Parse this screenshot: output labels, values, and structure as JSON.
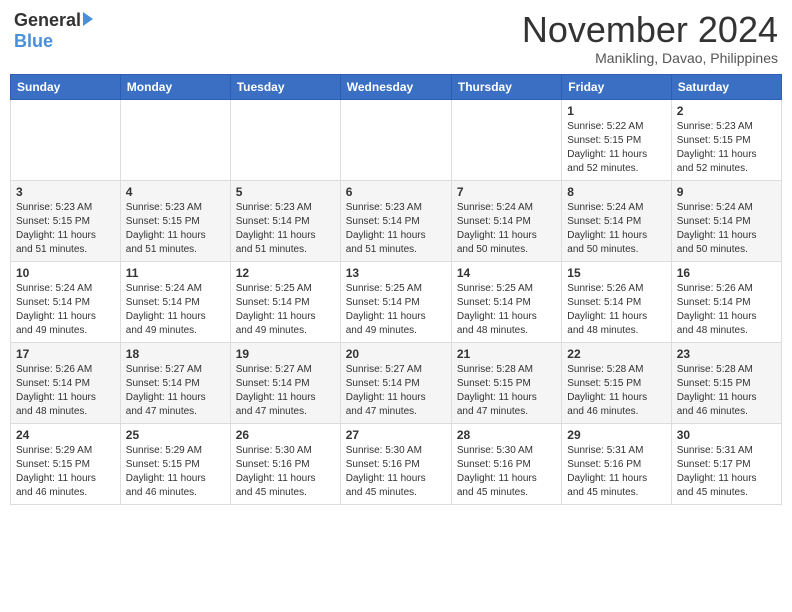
{
  "header": {
    "logo_general": "General",
    "logo_blue": "Blue",
    "month_title": "November 2024",
    "location": "Manikling, Davao, Philippines"
  },
  "calendar": {
    "days_of_week": [
      "Sunday",
      "Monday",
      "Tuesday",
      "Wednesday",
      "Thursday",
      "Friday",
      "Saturday"
    ],
    "weeks": [
      [
        {
          "day": "",
          "info": ""
        },
        {
          "day": "",
          "info": ""
        },
        {
          "day": "",
          "info": ""
        },
        {
          "day": "",
          "info": ""
        },
        {
          "day": "",
          "info": ""
        },
        {
          "day": "1",
          "info": "Sunrise: 5:22 AM\nSunset: 5:15 PM\nDaylight: 11 hours\nand 52 minutes."
        },
        {
          "day": "2",
          "info": "Sunrise: 5:23 AM\nSunset: 5:15 PM\nDaylight: 11 hours\nand 52 minutes."
        }
      ],
      [
        {
          "day": "3",
          "info": "Sunrise: 5:23 AM\nSunset: 5:15 PM\nDaylight: 11 hours\nand 51 minutes."
        },
        {
          "day": "4",
          "info": "Sunrise: 5:23 AM\nSunset: 5:15 PM\nDaylight: 11 hours\nand 51 minutes."
        },
        {
          "day": "5",
          "info": "Sunrise: 5:23 AM\nSunset: 5:14 PM\nDaylight: 11 hours\nand 51 minutes."
        },
        {
          "day": "6",
          "info": "Sunrise: 5:23 AM\nSunset: 5:14 PM\nDaylight: 11 hours\nand 51 minutes."
        },
        {
          "day": "7",
          "info": "Sunrise: 5:24 AM\nSunset: 5:14 PM\nDaylight: 11 hours\nand 50 minutes."
        },
        {
          "day": "8",
          "info": "Sunrise: 5:24 AM\nSunset: 5:14 PM\nDaylight: 11 hours\nand 50 minutes."
        },
        {
          "day": "9",
          "info": "Sunrise: 5:24 AM\nSunset: 5:14 PM\nDaylight: 11 hours\nand 50 minutes."
        }
      ],
      [
        {
          "day": "10",
          "info": "Sunrise: 5:24 AM\nSunset: 5:14 PM\nDaylight: 11 hours\nand 49 minutes."
        },
        {
          "day": "11",
          "info": "Sunrise: 5:24 AM\nSunset: 5:14 PM\nDaylight: 11 hours\nand 49 minutes."
        },
        {
          "day": "12",
          "info": "Sunrise: 5:25 AM\nSunset: 5:14 PM\nDaylight: 11 hours\nand 49 minutes."
        },
        {
          "day": "13",
          "info": "Sunrise: 5:25 AM\nSunset: 5:14 PM\nDaylight: 11 hours\nand 49 minutes."
        },
        {
          "day": "14",
          "info": "Sunrise: 5:25 AM\nSunset: 5:14 PM\nDaylight: 11 hours\nand 48 minutes."
        },
        {
          "day": "15",
          "info": "Sunrise: 5:26 AM\nSunset: 5:14 PM\nDaylight: 11 hours\nand 48 minutes."
        },
        {
          "day": "16",
          "info": "Sunrise: 5:26 AM\nSunset: 5:14 PM\nDaylight: 11 hours\nand 48 minutes."
        }
      ],
      [
        {
          "day": "17",
          "info": "Sunrise: 5:26 AM\nSunset: 5:14 PM\nDaylight: 11 hours\nand 48 minutes."
        },
        {
          "day": "18",
          "info": "Sunrise: 5:27 AM\nSunset: 5:14 PM\nDaylight: 11 hours\nand 47 minutes."
        },
        {
          "day": "19",
          "info": "Sunrise: 5:27 AM\nSunset: 5:14 PM\nDaylight: 11 hours\nand 47 minutes."
        },
        {
          "day": "20",
          "info": "Sunrise: 5:27 AM\nSunset: 5:14 PM\nDaylight: 11 hours\nand 47 minutes."
        },
        {
          "day": "21",
          "info": "Sunrise: 5:28 AM\nSunset: 5:15 PM\nDaylight: 11 hours\nand 47 minutes."
        },
        {
          "day": "22",
          "info": "Sunrise: 5:28 AM\nSunset: 5:15 PM\nDaylight: 11 hours\nand 46 minutes."
        },
        {
          "day": "23",
          "info": "Sunrise: 5:28 AM\nSunset: 5:15 PM\nDaylight: 11 hours\nand 46 minutes."
        }
      ],
      [
        {
          "day": "24",
          "info": "Sunrise: 5:29 AM\nSunset: 5:15 PM\nDaylight: 11 hours\nand 46 minutes."
        },
        {
          "day": "25",
          "info": "Sunrise: 5:29 AM\nSunset: 5:15 PM\nDaylight: 11 hours\nand 46 minutes."
        },
        {
          "day": "26",
          "info": "Sunrise: 5:30 AM\nSunset: 5:16 PM\nDaylight: 11 hours\nand 45 minutes."
        },
        {
          "day": "27",
          "info": "Sunrise: 5:30 AM\nSunset: 5:16 PM\nDaylight: 11 hours\nand 45 minutes."
        },
        {
          "day": "28",
          "info": "Sunrise: 5:30 AM\nSunset: 5:16 PM\nDaylight: 11 hours\nand 45 minutes."
        },
        {
          "day": "29",
          "info": "Sunrise: 5:31 AM\nSunset: 5:16 PM\nDaylight: 11 hours\nand 45 minutes."
        },
        {
          "day": "30",
          "info": "Sunrise: 5:31 AM\nSunset: 5:17 PM\nDaylight: 11 hours\nand 45 minutes."
        }
      ]
    ]
  }
}
